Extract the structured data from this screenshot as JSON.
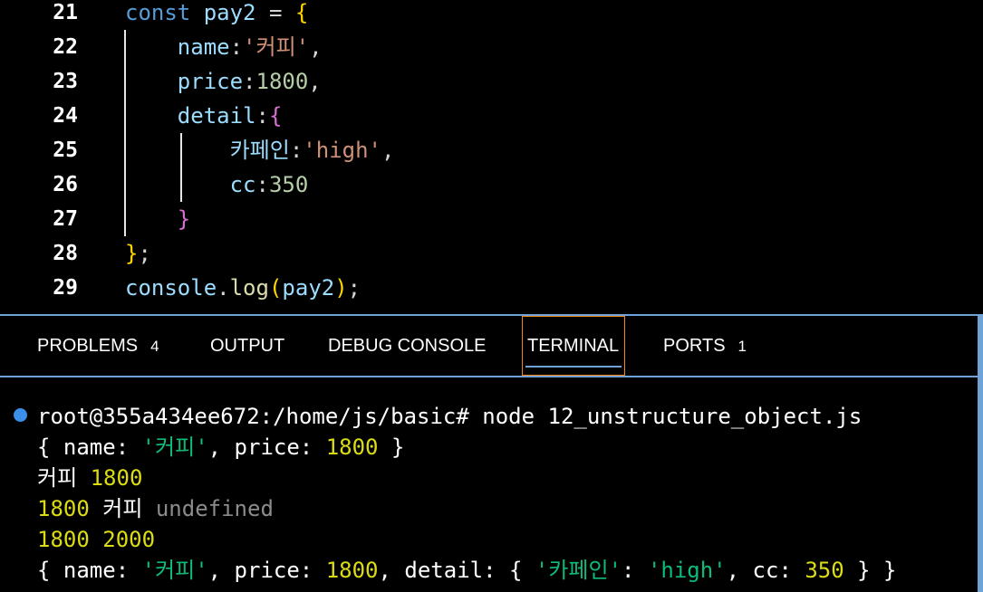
{
  "editor": {
    "lines": [
      {
        "n": "21",
        "tokens": [
          [
            "kw",
            "const "
          ],
          [
            "var",
            "pay2"
          ],
          [
            "pl",
            " = "
          ],
          [
            "br1",
            "{"
          ]
        ]
      },
      {
        "n": "22",
        "tokens": [
          [
            "pl",
            "    "
          ],
          [
            "prop",
            "name"
          ],
          [
            "pl",
            ":"
          ],
          [
            "str",
            "'커피'"
          ],
          [
            "pl",
            ","
          ]
        ]
      },
      {
        "n": "23",
        "tokens": [
          [
            "pl",
            "    "
          ],
          [
            "prop",
            "price"
          ],
          [
            "pl",
            ":"
          ],
          [
            "num",
            "1800"
          ],
          [
            "pl",
            ","
          ]
        ]
      },
      {
        "n": "24",
        "tokens": [
          [
            "pl",
            "    "
          ],
          [
            "prop",
            "detail"
          ],
          [
            "pl",
            ":"
          ],
          [
            "br2",
            "{"
          ]
        ]
      },
      {
        "n": "25",
        "tokens": [
          [
            "pl",
            "        "
          ],
          [
            "prop",
            "카페인"
          ],
          [
            "pl",
            ":"
          ],
          [
            "str",
            "'high'"
          ],
          [
            "pl",
            ","
          ]
        ]
      },
      {
        "n": "26",
        "tokens": [
          [
            "pl",
            "        "
          ],
          [
            "prop",
            "cc"
          ],
          [
            "pl",
            ":"
          ],
          [
            "num",
            "350"
          ]
        ]
      },
      {
        "n": "27",
        "tokens": [
          [
            "pl",
            "    "
          ],
          [
            "br2",
            "}"
          ]
        ]
      },
      {
        "n": "28",
        "tokens": [
          [
            "br1",
            "}"
          ],
          [
            "pl",
            ";"
          ]
        ]
      },
      {
        "n": "29",
        "tokens": [
          [
            "var",
            "console"
          ],
          [
            "pl",
            "."
          ],
          [
            "fn",
            "log"
          ],
          [
            "br1",
            "("
          ],
          [
            "var",
            "pay2"
          ],
          [
            "br1",
            ")"
          ],
          [
            "pl",
            ";"
          ]
        ]
      }
    ]
  },
  "panel": {
    "tabs": [
      {
        "label": "PROBLEMS",
        "badge": "4"
      },
      {
        "label": "OUTPUT",
        "badge": ""
      },
      {
        "label": "DEBUG CONSOLE",
        "badge": ""
      },
      {
        "label": "TERMINAL",
        "badge": ""
      },
      {
        "label": "PORTS",
        "badge": "1"
      }
    ],
    "active_tab": "TERMINAL"
  },
  "terminal": {
    "lines": [
      [
        [
          "w",
          "root@355a434ee672:/home/js/basic# node 12_unstructure_object.js"
        ]
      ],
      [
        [
          "w",
          "{ name: "
        ],
        [
          "s",
          "'커피'"
        ],
        [
          "w",
          ", price: "
        ],
        [
          "n",
          "1800"
        ],
        [
          "w",
          " }"
        ]
      ],
      [
        [
          "w",
          "커피 "
        ],
        [
          "n",
          "1800"
        ]
      ],
      [
        [
          "n",
          "1800"
        ],
        [
          "w",
          " 커피 "
        ],
        [
          "g",
          "undefined"
        ]
      ],
      [
        [
          "n",
          "1800"
        ],
        [
          "w",
          " "
        ],
        [
          "n",
          "2000"
        ]
      ],
      [
        [
          "w",
          "{ name: "
        ],
        [
          "s",
          "'커피'"
        ],
        [
          "w",
          ", price: "
        ],
        [
          "n",
          "1800"
        ],
        [
          "w",
          ", detail: { "
        ],
        [
          "s",
          "'카페인'"
        ],
        [
          "w",
          ": "
        ],
        [
          "s",
          "'high'"
        ],
        [
          "w",
          ", cc: "
        ],
        [
          "n",
          "350"
        ],
        [
          "w",
          " } }"
        ]
      ]
    ]
  },
  "colors": {
    "accent": "#6fa3d6",
    "active_tab_border": "#f38518",
    "prompt_dot": "#3b8eea"
  }
}
